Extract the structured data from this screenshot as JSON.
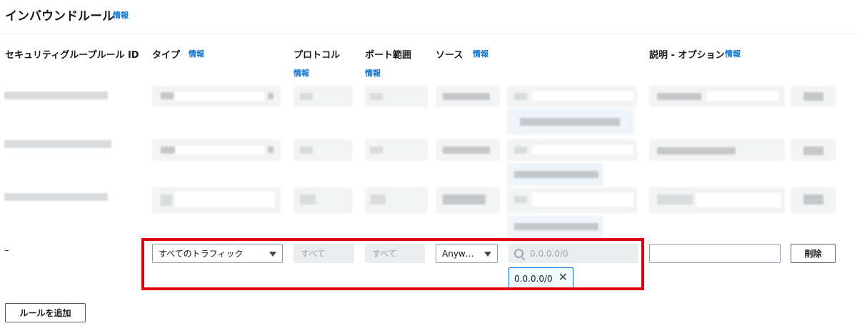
{
  "header": {
    "title": "インバウンドルール",
    "info_label": "情報"
  },
  "columns": {
    "rule_id": "セキュリティグループルール ID",
    "type": "タイプ",
    "protocol": "プロトコル",
    "port_range": "ポート範囲",
    "source": "ソース",
    "description": "説明 - オプション",
    "info_label": "情報"
  },
  "new_rule": {
    "id_placeholder": "–",
    "type_value": "すべてのトラフィック",
    "protocol_value": "すべて",
    "port_value": "すべて",
    "source_type_value": "Anyw…",
    "cidr_placeholder": "0.0.0.0/0",
    "cidr_token": "0.0.0.0/0",
    "token_remove_glyph": "✕",
    "delete_label": "削除"
  },
  "footer": {
    "add_rule_label": "ルールを追加"
  },
  "colors": {
    "link": "#0972d3",
    "highlight": "#e0000e",
    "token_border": "#0972d3"
  }
}
